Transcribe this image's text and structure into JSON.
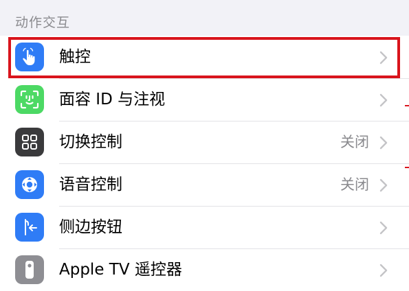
{
  "section": {
    "title": "动作交互"
  },
  "colors": {
    "accent_highlight": "#d9141c",
    "touch_icon_bg": "#2f7cf6",
    "faceid_icon_bg": "#4cd964",
    "switch_icon_bg": "#3a3a3c",
    "voice_icon_bg": "#2f7cf6",
    "side_icon_bg": "#2f7cf6",
    "remote_icon_bg": "#8e8e93"
  },
  "rows": [
    {
      "label": "触控",
      "icon": "hand-pointer-icon",
      "value": ""
    },
    {
      "label": "面容 ID 与注视",
      "icon": "face-id-icon",
      "value": ""
    },
    {
      "label": "切换控制",
      "icon": "grid-squares-icon",
      "value": "关闭"
    },
    {
      "label": "语音控制",
      "icon": "voice-control-icon",
      "value": "关闭"
    },
    {
      "label": "侧边按钮",
      "icon": "side-button-icon",
      "value": ""
    },
    {
      "label": "Apple TV 遥控器",
      "icon": "remote-icon",
      "value": ""
    }
  ]
}
